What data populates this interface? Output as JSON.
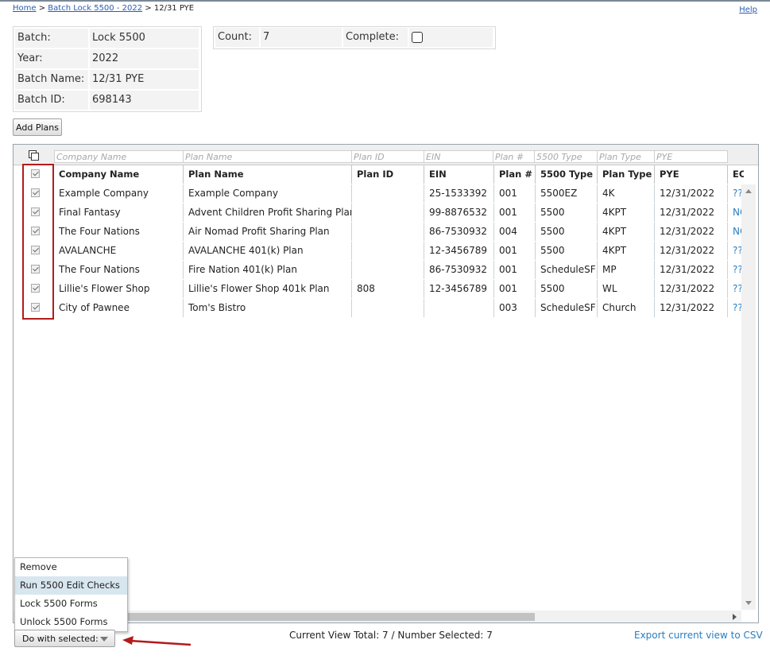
{
  "breadcrumb": {
    "home": "Home",
    "sep1": ">",
    "batch": "Batch Lock 5500 - 2022",
    "sep2": ">",
    "current": "12/31 PYE"
  },
  "help": "Help",
  "info": {
    "batch_label": "Batch:",
    "batch_value": "Lock 5500",
    "year_label": "Year:",
    "year_value": "2022",
    "name_label": "Batch Name:",
    "name_value": "12/31 PYE",
    "id_label": "Batch ID:",
    "id_value": "698143",
    "count_label": "Count:",
    "count_value": "7",
    "complete_label": "Complete:"
  },
  "add_plans": "Add Plans",
  "filters": [
    "Company Name",
    "Plan Name",
    "Plan ID",
    "EIN",
    "Plan #",
    "5500 Type",
    "Plan Type",
    "PYE"
  ],
  "columns": [
    "Company Name",
    "Plan Name",
    "Plan ID",
    "EIN",
    "Plan #",
    "5500 Type",
    "Plan Type",
    "PYE",
    "EC St"
  ],
  "rows": [
    {
      "company": "Example Company",
      "plan": "Example Company",
      "plan_id": "",
      "ein": "25-1533392",
      "num": "001",
      "type": "5500EZ",
      "plan_type": "4K",
      "pye": "12/31/2022",
      "ec": "??"
    },
    {
      "company": "Final Fantasy",
      "plan": "Advent Children Profit Sharing Plan",
      "plan_id": "",
      "ein": "99-8876532",
      "num": "001",
      "type": "5500",
      "plan_type": "4KPT",
      "pye": "12/31/2022",
      "ec": "NO"
    },
    {
      "company": "The Four Nations",
      "plan": "Air Nomad Profit Sharing Plan",
      "plan_id": "",
      "ein": "86-7530932",
      "num": "004",
      "type": "5500",
      "plan_type": "4KPT",
      "pye": "12/31/2022",
      "ec": "NO"
    },
    {
      "company": "AVALANCHE",
      "plan": "AVALANCHE 401(k) Plan",
      "plan_id": "",
      "ein": "12-3456789",
      "num": "001",
      "type": "5500",
      "plan_type": "4KPT",
      "pye": "12/31/2022",
      "ec": "??"
    },
    {
      "company": "The Four Nations",
      "plan": "Fire Nation 401(k) Plan",
      "plan_id": "",
      "ein": "86-7530932",
      "num": "001",
      "type": "ScheduleSF",
      "plan_type": "MP",
      "pye": "12/31/2022",
      "ec": "??"
    },
    {
      "company": "Lillie's Flower Shop",
      "plan": "Lillie's Flower Shop 401k Plan",
      "plan_id": "808",
      "ein": "12-3456789",
      "num": "001",
      "type": "5500",
      "plan_type": "WL",
      "pye": "12/31/2022",
      "ec": "??"
    },
    {
      "company": "City of Pawnee",
      "plan": "Tom's Bistro",
      "plan_id": "",
      "ein": "",
      "num": "003",
      "type": "ScheduleSF",
      "plan_type": "Church",
      "pye": "12/31/2022",
      "ec": "??"
    }
  ],
  "menu": [
    "Remove",
    "Run 5500 Edit Checks",
    "Lock 5500 Forms",
    "Unlock 5500 Forms"
  ],
  "do_with_selected": "Do with selected:",
  "status": "Current View Total: 7 / Number Selected: 7",
  "export": "Export current view to CSV"
}
